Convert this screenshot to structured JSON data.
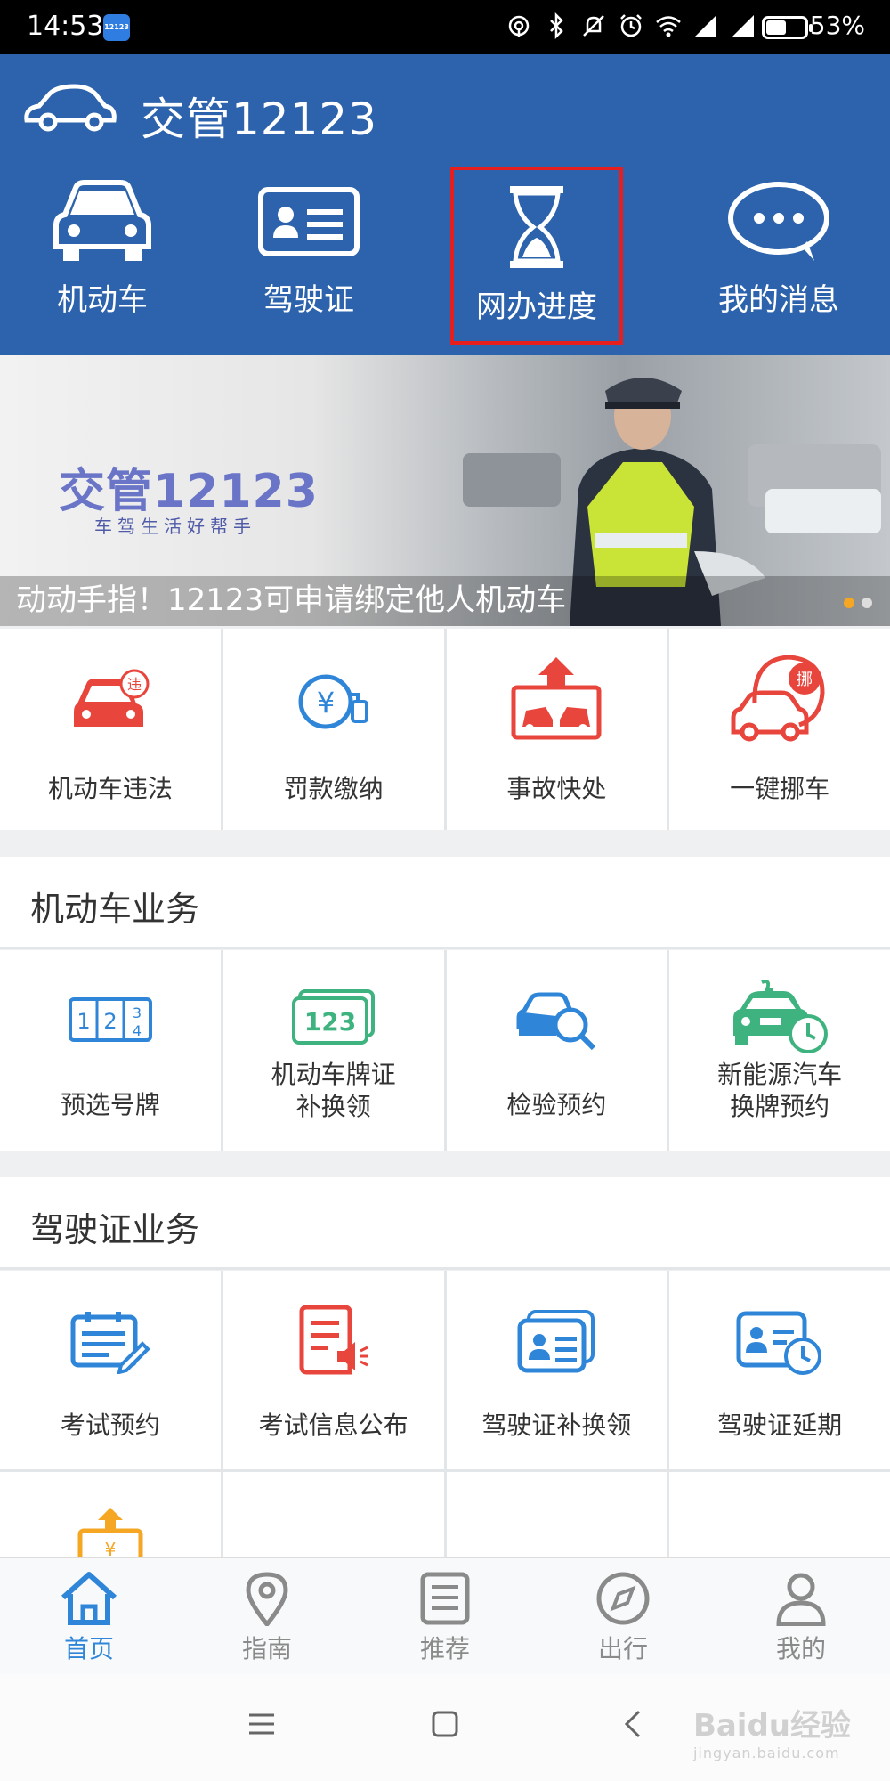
{
  "status_bar": {
    "time": "14:53",
    "app_icon_text": "12123",
    "battery_percent": "53%",
    "battery_level": 0.53,
    "icons": [
      "hotspot-icon",
      "bluetooth-icon",
      "mute-icon",
      "alarm-icon",
      "wifi-icon",
      "signal-icon",
      "signal-icon-2"
    ]
  },
  "header": {
    "title": "交管12123",
    "quick_actions": [
      {
        "label": "机动车",
        "icon": "car-icon"
      },
      {
        "label": "驾驶证",
        "icon": "license-card-icon"
      },
      {
        "label": "网办进度",
        "icon": "hourglass-icon",
        "highlighted": true
      },
      {
        "label": "我的消息",
        "icon": "chat-bubble-icon"
      }
    ]
  },
  "banner": {
    "logo_text": "交管12123",
    "slogan": "车驾生活好帮手",
    "caption": "动动手指！12123可申请绑定他人机动车",
    "dots": 2,
    "active_dot": 0
  },
  "top_services": [
    {
      "label": "机动车违法",
      "icon": "violation-car-icon"
    },
    {
      "label": "罚款缴纳",
      "icon": "fine-payment-icon"
    },
    {
      "label": "事故快处",
      "icon": "accident-icon"
    },
    {
      "label": "一键挪车",
      "icon": "move-car-icon"
    }
  ],
  "vehicle_section": {
    "title": "机动车业务",
    "items": [
      {
        "label": "预选号牌",
        "icon": "plate-number-icon"
      },
      {
        "label": "机动车牌证\n补换领",
        "icon": "plate-replace-icon"
      },
      {
        "label": "检验预约",
        "icon": "inspection-icon"
      },
      {
        "label": "新能源汽车\n换牌预约",
        "icon": "new-energy-icon"
      }
    ]
  },
  "license_section": {
    "title": "驾驶证业务",
    "items": [
      {
        "label": "考试预约",
        "icon": "exam-booking-icon"
      },
      {
        "label": "考试信息公布",
        "icon": "exam-info-icon"
      },
      {
        "label": "驾驶证补换领",
        "icon": "license-replace-icon"
      },
      {
        "label": "驾驶证延期",
        "icon": "license-extend-icon"
      }
    ]
  },
  "bottom_nav": [
    {
      "label": "首页",
      "icon": "home-icon",
      "active": true
    },
    {
      "label": "指南",
      "icon": "location-pin-icon"
    },
    {
      "label": "推荐",
      "icon": "list-doc-icon"
    },
    {
      "label": "出行",
      "icon": "compass-icon"
    },
    {
      "label": "我的",
      "icon": "user-icon"
    }
  ],
  "watermark": {
    "text": "Baidu经验",
    "sub": "jingyan.baidu.com"
  },
  "colors": {
    "header_bg": "#2d63ad",
    "accent_blue": "#2f86d8",
    "red": "#e8453c",
    "green": "#3fb37f",
    "highlight": "#e61e1e"
  }
}
